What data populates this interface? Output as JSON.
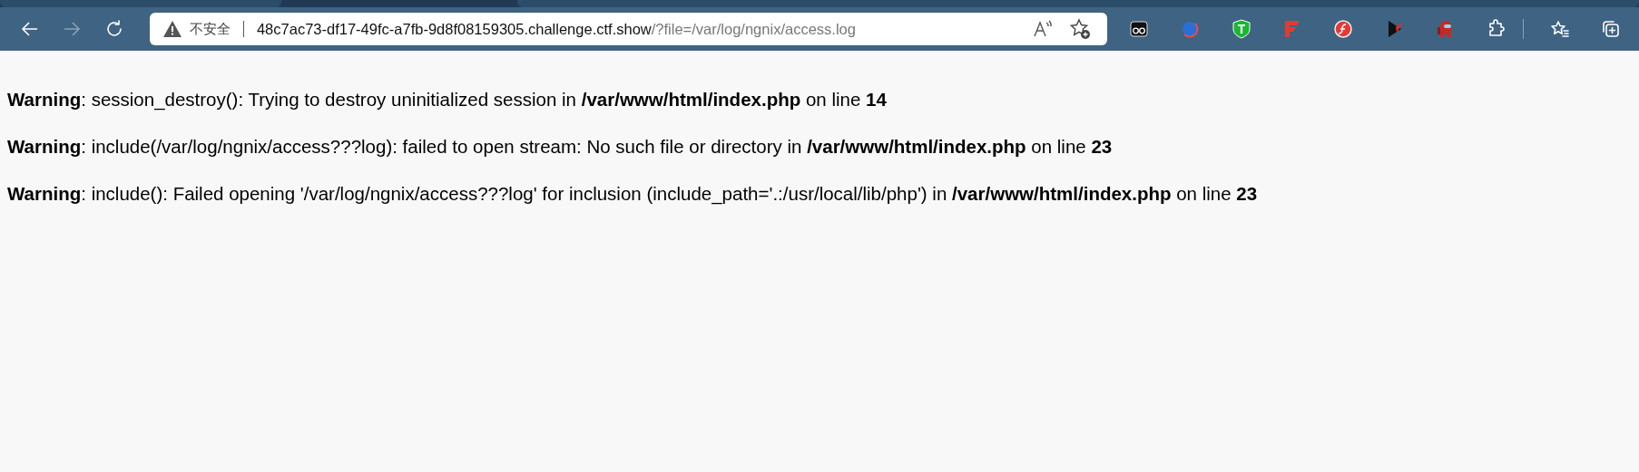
{
  "toolbar": {
    "back": {
      "disabled": false
    },
    "forward": {
      "disabled": true
    }
  },
  "address_bar": {
    "security_label": "不安全",
    "host": "48c7ac73-df17-49fc-a7fb-9d8f08159305.challenge.ctf.show",
    "path": "/?file=/var/log/ngnix/access.log"
  },
  "messages": [
    "**Warning**: session_destroy(): Trying to destroy uninitialized session in **/var/www/html/index.php** on line **14**",
    "**Warning**: include(/var/log/ngnix/access???log): failed to open stream: No such file or directory in **/var/www/html/index.php** on line **23**",
    "**Warning**: include(): Failed opening '/var/log/ngnix/access???log' for inclusion (include_path='.:/usr/local/lib/php') in **/var/www/html/index.php** on line **23**"
  ]
}
